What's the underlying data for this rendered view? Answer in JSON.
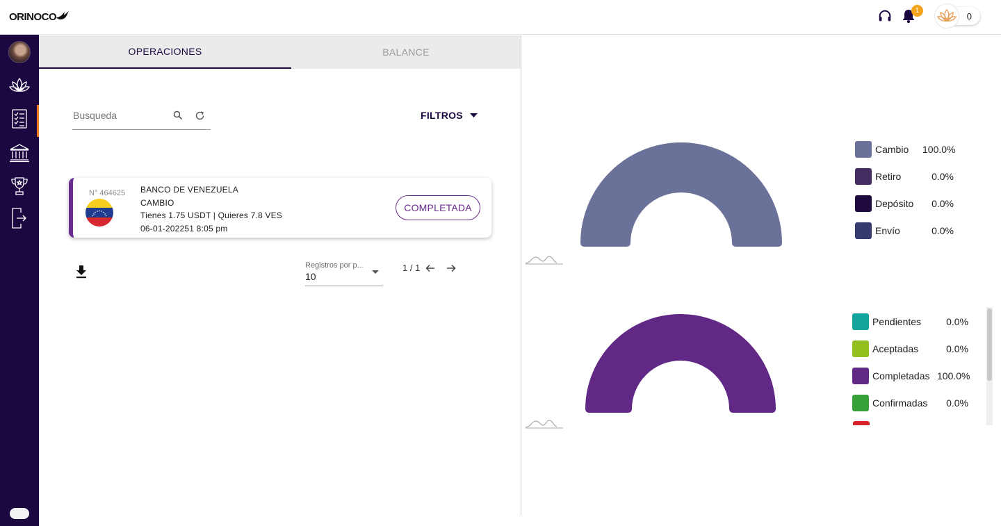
{
  "brand": {
    "name": "ORINOCO"
  },
  "header": {
    "notification_count": "1",
    "points": "0"
  },
  "tabs": [
    {
      "label": "OPERACIONES",
      "active": true
    },
    {
      "label": "BALANCE",
      "active": false
    }
  ],
  "search": {
    "placeholder": "Busqueda",
    "value": ""
  },
  "filters": {
    "label": "FILTROS"
  },
  "operations": [
    {
      "number": "N° 464625",
      "bank": "BANCO DE VENEZUELA",
      "type": "CAMBIO",
      "detail": "Tienes 1.75 USDT | Quieres 7.8 VES",
      "date": "06-01-202251 8:05 pm",
      "status": "COMPLETADA",
      "flag": "venezuela-flag"
    }
  ],
  "pagination": {
    "per_page_label": "Registros por p...",
    "per_page_value": "10",
    "page_info": "1 / 1"
  },
  "colors": {
    "sidebar": "#1c0840",
    "accent": "#6a2c8f",
    "active_indicator": "#f07b24"
  },
  "chart_data": [
    {
      "type": "pie",
      "title": "",
      "categories": [
        "Cambio",
        "Retiro",
        "Depósito",
        "Envío"
      ],
      "values": [
        100.0,
        0.0,
        0.0,
        0.0
      ],
      "labels": [
        "100.0%",
        "0.0%",
        "0.0%",
        "0.0%"
      ],
      "colors": [
        "#6b7299",
        "#442d60",
        "#1f0a3e",
        "#363a6d"
      ]
    },
    {
      "type": "pie",
      "title": "",
      "categories": [
        "Pendientes",
        "Aceptadas",
        "Completadas",
        "Confirmadas"
      ],
      "values": [
        0.0,
        0.0,
        100.0,
        0.0
      ],
      "labels": [
        "0.0%",
        "0.0%",
        "100.0%",
        "0.0%"
      ],
      "colors": [
        "#13a59c",
        "#93c01f",
        "#622885",
        "#37a23a"
      ]
    }
  ]
}
